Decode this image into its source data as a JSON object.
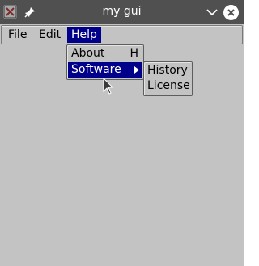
{
  "window": {
    "title": "my gui"
  },
  "menubar": {
    "items": [
      {
        "label": "File"
      },
      {
        "label": "Edit"
      },
      {
        "label": "Help"
      }
    ]
  },
  "help_menu": {
    "about_label": "About",
    "about_accelerator": "H",
    "software_label": "Software"
  },
  "software_submenu": {
    "items": [
      {
        "label": "History"
      },
      {
        "label": "License"
      }
    ]
  },
  "colors": {
    "titlebar": "#505050",
    "window_bg": "#c3c3c3",
    "selection": "#00008a"
  }
}
